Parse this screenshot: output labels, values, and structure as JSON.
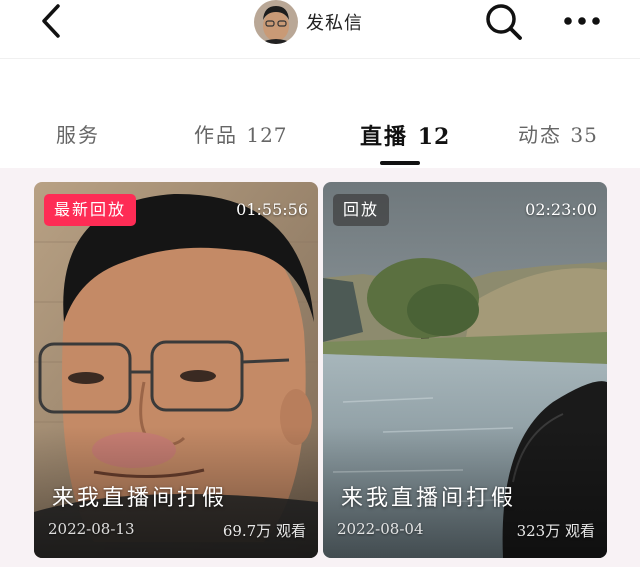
{
  "header": {
    "private_message_label": "发私信",
    "icons": {
      "back": "chevron-left-icon",
      "search": "search-icon",
      "more": "more-horizontal-icon"
    }
  },
  "tabs": [
    {
      "label": "服务",
      "count": ""
    },
    {
      "label": "作品",
      "count": "127"
    },
    {
      "label": "直播",
      "count": "12",
      "active": true
    },
    {
      "label": "动态",
      "count": "35"
    }
  ],
  "cards": [
    {
      "badge": "最新回放",
      "badge_color": "#fe2c55",
      "duration": "01:55:56",
      "title": "来我直播间打假",
      "date": "2022-08-13",
      "views": "69.7万 观看"
    },
    {
      "badge": "回放",
      "badge_color": "#555555",
      "duration": "02:23:00",
      "title": "来我直播间打假",
      "date": "2022-08-04",
      "views": "323万 观看"
    }
  ]
}
